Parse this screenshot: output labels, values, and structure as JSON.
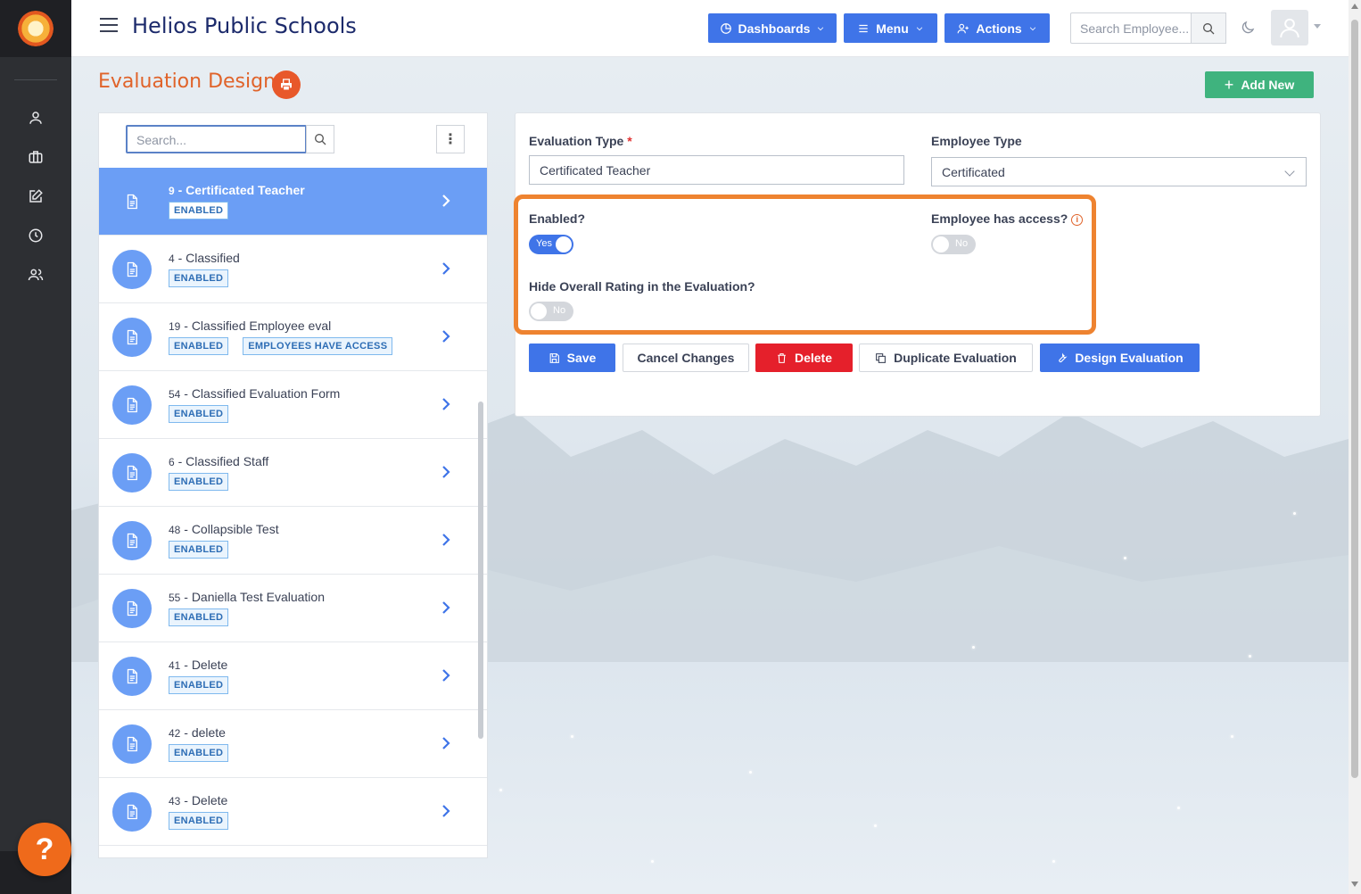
{
  "header": {
    "brand": "Helios Public Schools",
    "dashboards_label": "Dashboards",
    "menu_label": "Menu",
    "actions_label": "Actions",
    "search_placeholder": "Search Employee..."
  },
  "page": {
    "title": "Evaluation Designer",
    "add_new_label": "Add New"
  },
  "list": {
    "search_placeholder": "Search...",
    "items": [
      {
        "num": "9",
        "name": "Certificated Teacher",
        "badges": [
          "ENABLED"
        ],
        "active": true
      },
      {
        "num": "4",
        "name": "Classified",
        "badges": [
          "ENABLED"
        ]
      },
      {
        "num": "19",
        "name": "Classified Employee eval",
        "badges": [
          "ENABLED",
          "EMPLOYEES HAVE ACCESS"
        ]
      },
      {
        "num": "54",
        "name": "Classified Evaluation Form",
        "badges": [
          "ENABLED"
        ]
      },
      {
        "num": "6",
        "name": "Classified Staff",
        "badges": [
          "ENABLED"
        ]
      },
      {
        "num": "48",
        "name": "Collapsible Test",
        "badges": [
          "ENABLED"
        ]
      },
      {
        "num": "55",
        "name": "Daniella Test Evaluation",
        "badges": [
          "ENABLED"
        ]
      },
      {
        "num": "41",
        "name": "Delete",
        "badges": [
          "ENABLED"
        ]
      },
      {
        "num": "42",
        "name": "delete",
        "badges": [
          "ENABLED"
        ]
      },
      {
        "num": "43",
        "name": "Delete",
        "badges": [
          "ENABLED"
        ]
      }
    ]
  },
  "form": {
    "eval_type_label": "Evaluation Type",
    "eval_type_required": "*",
    "eval_type_value": "Certificated Teacher",
    "employee_type_label": "Employee Type",
    "employee_type_value": "Certificated",
    "enabled_label": "Enabled?",
    "enabled_state": "Yes",
    "access_label": "Employee has access?",
    "access_state": "No",
    "hide_rating_label": "Hide Overall Rating in the Evaluation?",
    "hide_rating_state": "No"
  },
  "actions": {
    "save": "Save",
    "cancel": "Cancel Changes",
    "delete": "Delete",
    "duplicate": "Duplicate Evaluation",
    "design": "Design Evaluation"
  },
  "help_label": "?",
  "colors": {
    "primary": "#3f74e8",
    "accent_orange": "#e0632a",
    "success": "#3fb37e",
    "danger": "#e5202b",
    "highlight": "#ee8330"
  }
}
